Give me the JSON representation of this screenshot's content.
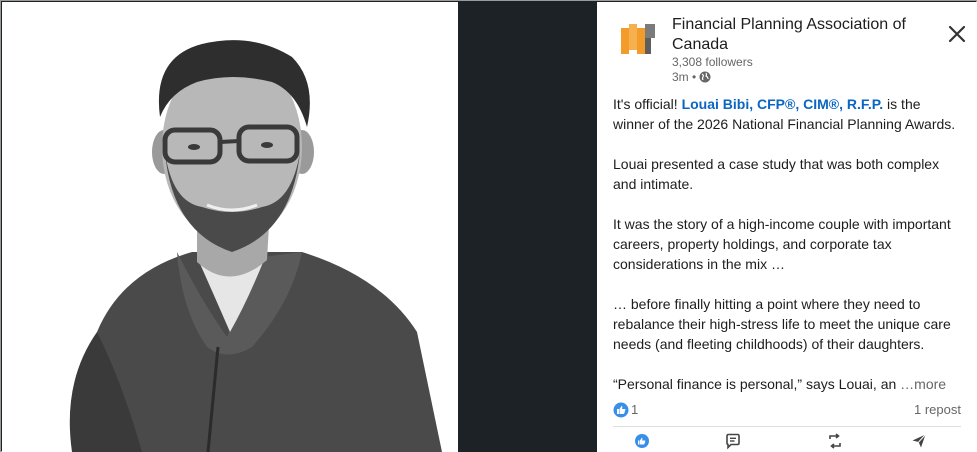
{
  "post": {
    "org_name": "Financial Planning Association of Canada",
    "followers": "3,308 followers",
    "time": "3m •",
    "body": {
      "p1_pre": "It's official! ",
      "p1_mention": "Louai Bibi, CFP®, CIM®, R.F.P.",
      "p1_post": " is the winner of the 2026 National Financial Planning Awards.",
      "p2": "Louai presented a case study that was both complex and intimate.",
      "p3": "It was the story of a high-income couple with important careers, property holdings, and corporate tax considerations in the mix …",
      "p4": "… before finally hitting a point where they need to rebalance their high-stress life to meet the unique care needs (and fleeting childhoods) of their daughters.",
      "p5": "“Personal finance is personal,” says Louai, an ",
      "more": "…more"
    },
    "reactions_count": "1",
    "reposts": "1 repost"
  },
  "icons": {
    "logo": "fpac-logo",
    "close": "close-icon",
    "globe": "globe-icon",
    "like": "like-icon",
    "comment": "comment-icon",
    "repost": "repost-icon",
    "send": "send-icon"
  },
  "colors": {
    "link": "#0a66c2",
    "logo_orange": "#f39c2b",
    "logo_gray": "#7b7b7b",
    "dark_bg": "#1d2226"
  }
}
